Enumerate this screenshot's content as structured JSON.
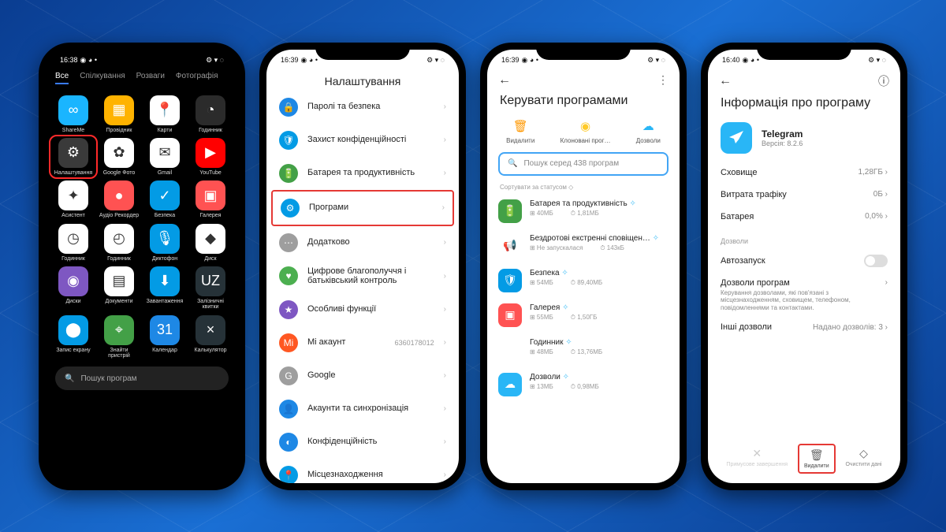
{
  "screen1": {
    "time": "16:38",
    "status_icons": "◉ ◕ •",
    "right_icons": "⚙ ▾ ◌",
    "tabs": [
      "Все",
      "Спілкування",
      "Розваги",
      "Фотографія"
    ],
    "apps": [
      {
        "label": "ShareMe",
        "color": "#1ab5ff",
        "glyph": "∞"
      },
      {
        "label": "Провідник",
        "color": "#ffb300",
        "glyph": "▦"
      },
      {
        "label": "Карти",
        "color": "#fff",
        "glyph": "📍"
      },
      {
        "label": "Годинник",
        "color": "#2b2b2b",
        "glyph": "◔"
      },
      {
        "label": "Налаштування",
        "color": "#3a3a3a",
        "glyph": "⚙",
        "hl": true
      },
      {
        "label": "Google Фото",
        "color": "#fff",
        "glyph": "✿"
      },
      {
        "label": "Gmail",
        "color": "#fff",
        "glyph": "✉"
      },
      {
        "label": "YouTube",
        "color": "#ff0000",
        "glyph": "▶"
      },
      {
        "label": "Асистент",
        "color": "#fff",
        "glyph": "✦"
      },
      {
        "label": "Аудіо Рекордер",
        "color": "#ff5252",
        "glyph": "●"
      },
      {
        "label": "Безпека",
        "color": "#039be5",
        "glyph": "✓"
      },
      {
        "label": "Галерея",
        "color": "#ff5252",
        "glyph": "▣"
      },
      {
        "label": "Годинник",
        "color": "#fff",
        "glyph": "◷"
      },
      {
        "label": "Годинник",
        "color": "#fff",
        "glyph": "◴"
      },
      {
        "label": "Диктофон",
        "color": "#039be5",
        "glyph": "🎙"
      },
      {
        "label": "Диск",
        "color": "#fff",
        "glyph": "◆"
      },
      {
        "label": "Диски",
        "color": "#7e57c2",
        "glyph": "◉"
      },
      {
        "label": "Документи",
        "color": "#fff",
        "glyph": "▤"
      },
      {
        "label": "Завантаження",
        "color": "#039be5",
        "glyph": "⬇"
      },
      {
        "label": "Залізничні квитки",
        "color": "#263238",
        "glyph": "UZ"
      },
      {
        "label": "Запис екрану",
        "color": "#039be5",
        "glyph": "⬤"
      },
      {
        "label": "Знайти пристрій",
        "color": "#43a047",
        "glyph": "⌖"
      },
      {
        "label": "Календар",
        "color": "#1e88e5",
        "glyph": "31"
      },
      {
        "label": "Калькулятор",
        "color": "#263238",
        "glyph": "×"
      }
    ],
    "search_placeholder": "Пошук програм"
  },
  "screen2": {
    "time": "16:39",
    "title": "Налаштування",
    "rows": [
      {
        "icon": "🔒",
        "bg": "#1e88e5",
        "label": "Паролі та безпека"
      },
      {
        "icon": "🛡",
        "bg": "#039be5",
        "label": "Захист конфіденційності"
      },
      {
        "icon": "🔋",
        "bg": "#43a047",
        "label": "Батарея та продуктивність"
      },
      {
        "icon": "⚙",
        "bg": "#039be5",
        "label": "Програми",
        "hl": true
      },
      {
        "icon": "⋯",
        "bg": "#9e9e9e",
        "label": "Додатково"
      },
      {
        "icon": "♥",
        "bg": "#4caf50",
        "label": "Цифрове благополуччя і батьківський контроль"
      },
      {
        "icon": "★",
        "bg": "#7e57c2",
        "label": "Особливі функції"
      },
      {
        "icon": "Mi",
        "bg": "#ff5722",
        "label": "Мі акаунт",
        "meta": "6360178012"
      },
      {
        "icon": "G",
        "bg": "#9e9e9e",
        "label": "Google"
      },
      {
        "icon": "👤",
        "bg": "#1e88e5",
        "label": "Акаунти та синхронізація"
      },
      {
        "icon": "◐",
        "bg": "#1e88e5",
        "label": "Конфіденційність"
      },
      {
        "icon": "📍",
        "bg": "#039be5",
        "label": "Місцезнаходження"
      }
    ]
  },
  "screen3": {
    "time": "16:39",
    "title": "Керувати програмами",
    "actions": [
      {
        "icon": "🗑",
        "color": "#ff9800",
        "label": "Видалити"
      },
      {
        "icon": "◉",
        "color": "#ffca28",
        "label": "Клоновані прог…"
      },
      {
        "icon": "☁",
        "color": "#29b6f6",
        "label": "Дозволи"
      }
    ],
    "search_placeholder": "Пошук серед 438 програм",
    "sort": "Сортувати за статусом ◇",
    "apps": [
      {
        "name": "Батарея та продуктивність",
        "size": "40МБ",
        "use": "1,81МБ",
        "bg": "#43a047",
        "glyph": "🔋"
      },
      {
        "name": "Бездротові екстренні сповіщен…",
        "size": "Не запускалася",
        "use": "143кБ",
        "bg": "#fff",
        "glyph": "📢"
      },
      {
        "name": "Безпека",
        "size": "54МБ",
        "use": "89,40МБ",
        "bg": "#039be5",
        "glyph": "🛡"
      },
      {
        "name": "Галерея",
        "size": "55МБ",
        "use": "1,50ГБ",
        "bg": "#ff5252",
        "glyph": "▣"
      },
      {
        "name": "Годинник",
        "size": "48МБ",
        "use": "13,76МБ",
        "bg": "#fff",
        "glyph": "◷"
      },
      {
        "name": "Дозволи",
        "size": "13МБ",
        "use": "0,98МБ",
        "bg": "#29b6f6",
        "glyph": "☁"
      }
    ]
  },
  "screen4": {
    "time": "16:40",
    "title": "Інформація про програму",
    "app_name": "Telegram",
    "version": "Версія: 8.2.6",
    "stats": [
      {
        "label": "Сховище",
        "value": "1,28ГБ"
      },
      {
        "label": "Витрата трафіку",
        "value": "0Б"
      },
      {
        "label": "Батарея",
        "value": "0,0%"
      }
    ],
    "section": "Дозволи",
    "autostart": "Автозапуск",
    "perm_title": "Дозволи програм",
    "perm_desc": "Керування дозволами, які пов'язані з місцезнаходженням, сховищем, телефоном, повідомленнями та контактами.",
    "other_perm": "Інші дозволи",
    "other_perm_val": "Надано дозволів: 3",
    "buttons": [
      {
        "icon": "✕",
        "label": "Примусове завершення",
        "disabled": true
      },
      {
        "icon": "🗑",
        "label": "Видалити",
        "hl": true
      },
      {
        "icon": "◇",
        "label": "Очистити дані"
      }
    ]
  }
}
